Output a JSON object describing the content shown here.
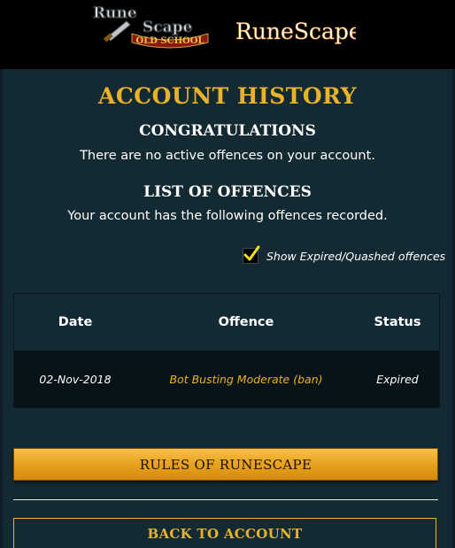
{
  "header": {
    "osrs_logo_text": "RuneScape",
    "osrs_logo_subtext": "OLD SCHOOL",
    "rs_logo_text": "RuneScape"
  },
  "page": {
    "title": "ACCOUNT HISTORY",
    "congrats_heading": "CONGRATULATIONS",
    "congrats_text": "There are no active offences on your account.",
    "list_heading": "LIST OF OFFENCES",
    "list_text": "Your account has the following offences recorded."
  },
  "filter": {
    "checked": true,
    "label": "Show Expired/Quashed offences"
  },
  "table": {
    "columns": [
      "Date",
      "Offence",
      "Status"
    ],
    "rows": [
      [
        "02-Nov-2018",
        "Bot Busting Moderate (ban)",
        "Expired"
      ]
    ]
  },
  "buttons": {
    "rules": "RULES OF RUNESCAPE",
    "back": "BACK TO ACCOUNT"
  },
  "colors": {
    "accent": "#e9b22a",
    "background": "#0e1e26",
    "panel": "#142a33"
  }
}
